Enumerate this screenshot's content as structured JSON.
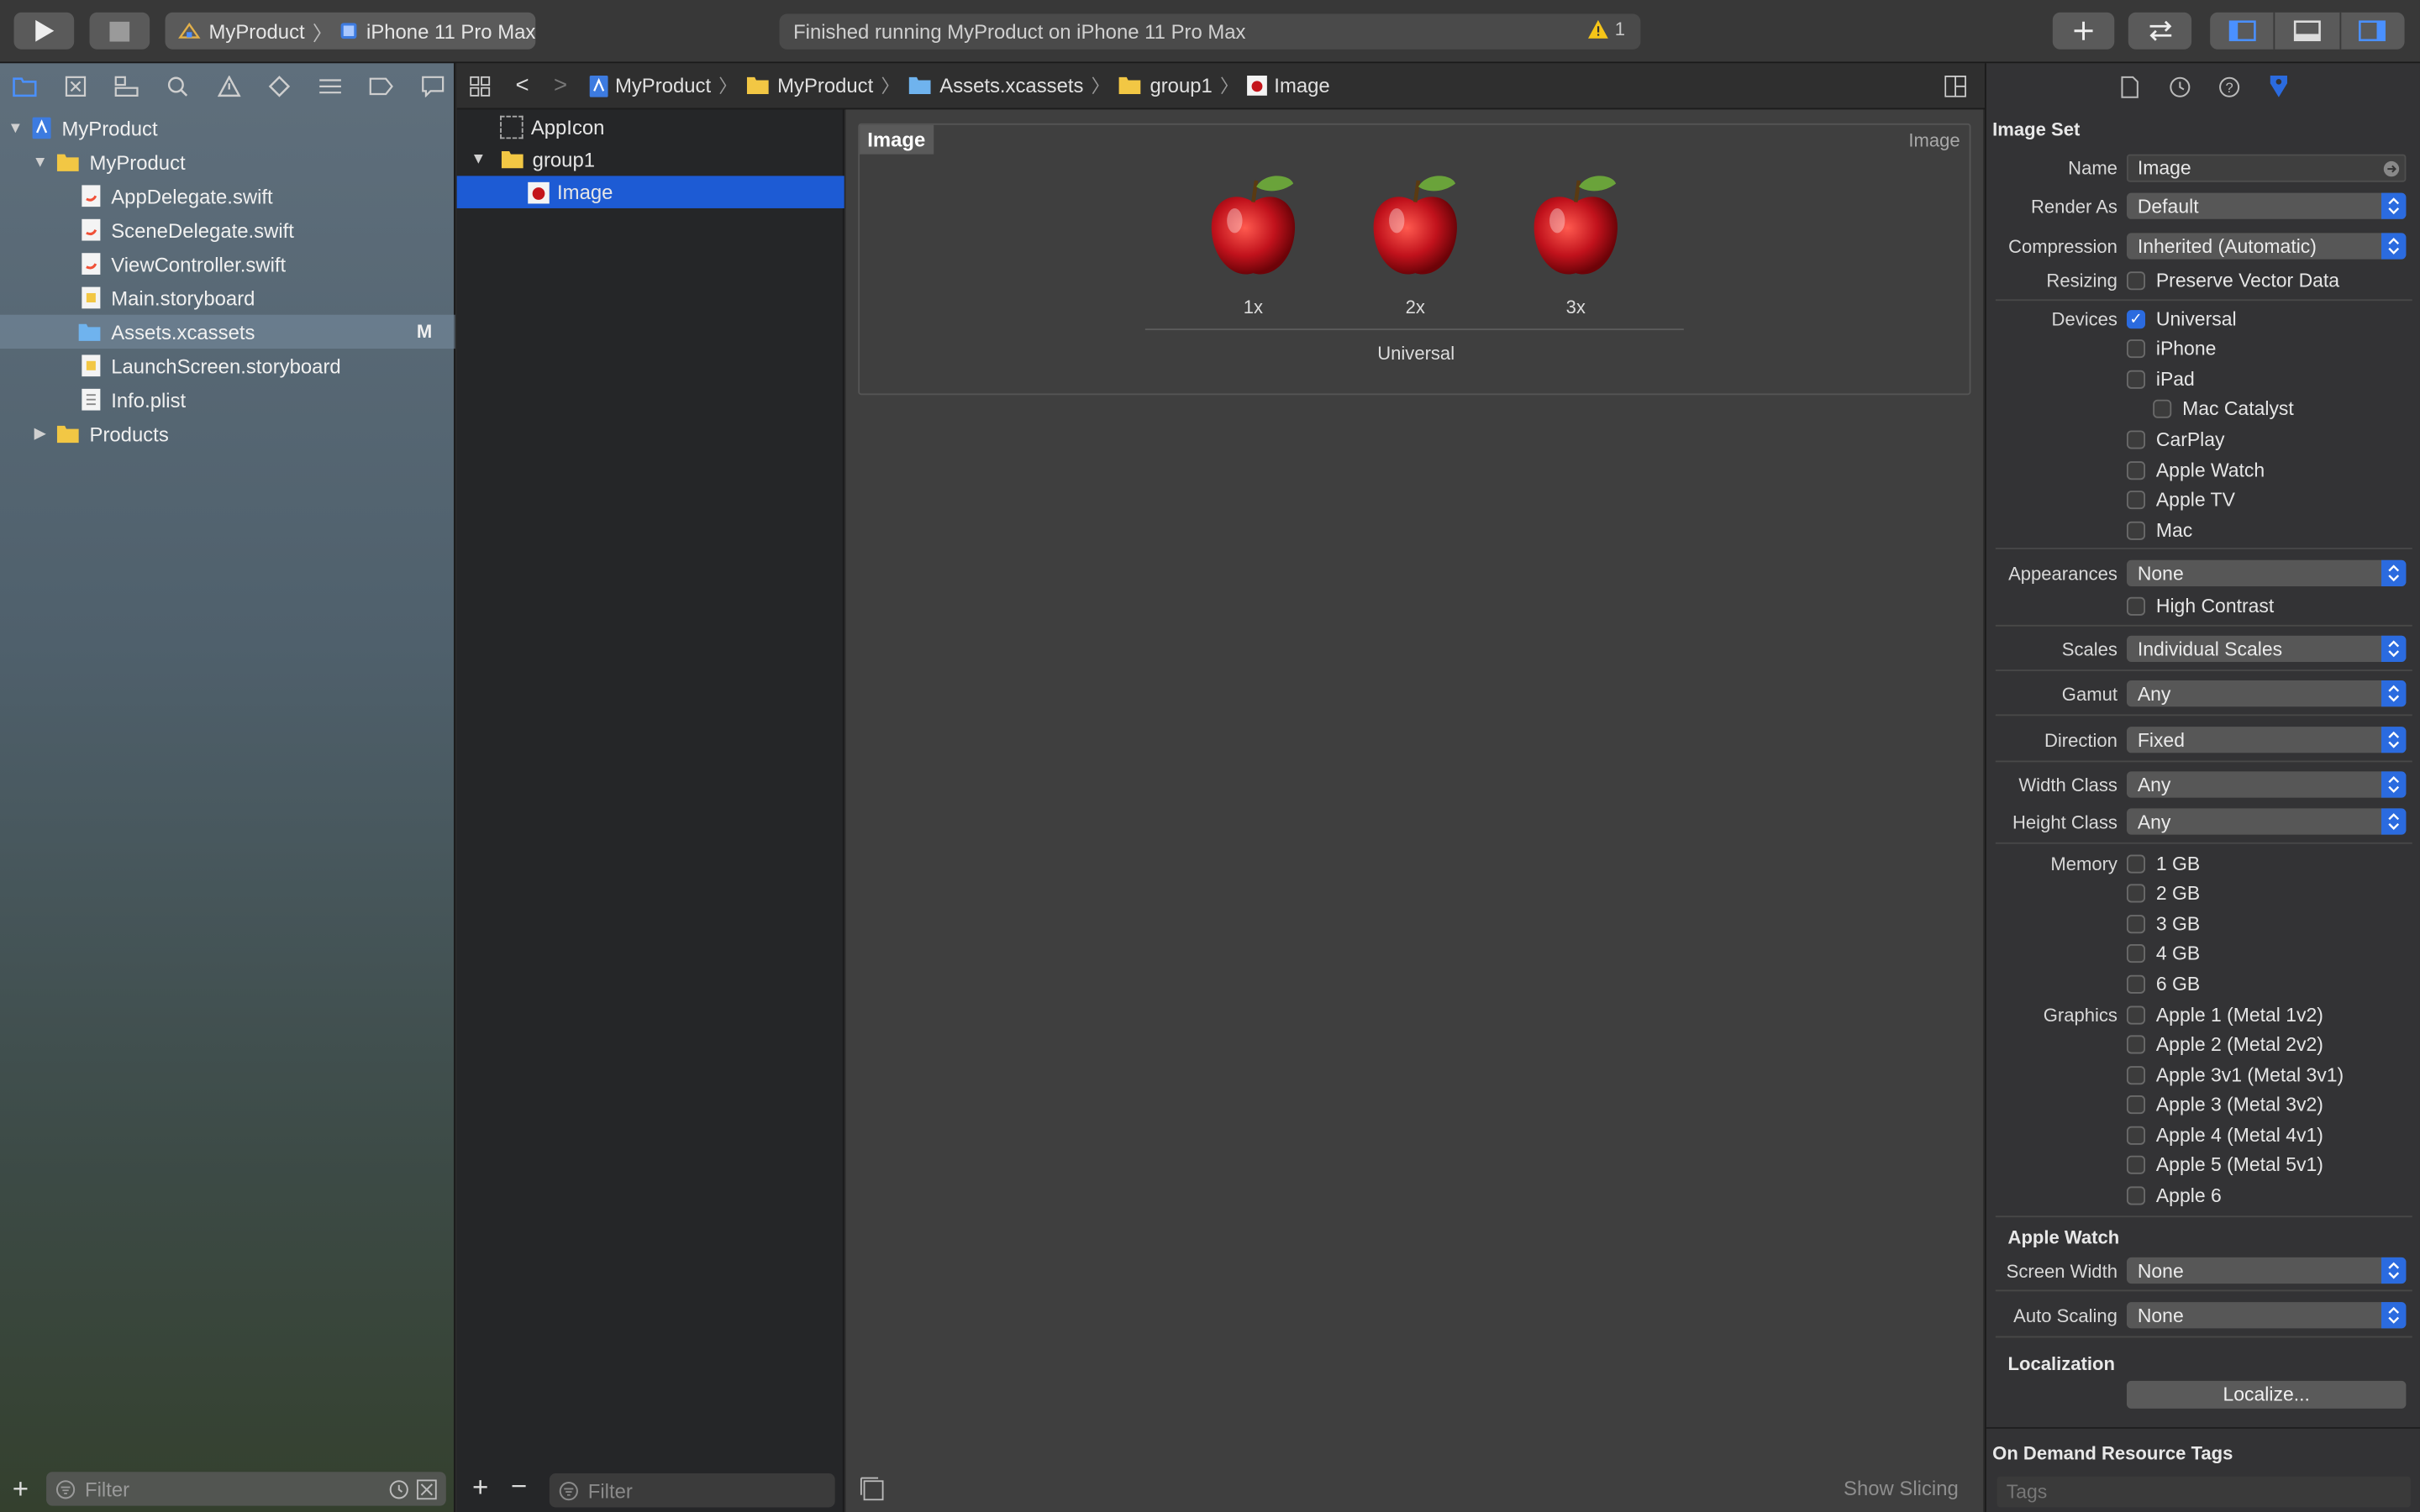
{
  "toolbar": {
    "scheme": {
      "project": "MyProduct",
      "device": "iPhone 11 Pro Max"
    },
    "activity_status": "Finished running MyProduct on iPhone 11 Pro Max",
    "warning_count": "1"
  },
  "navigator": {
    "tabs": [
      "project-navigator-icon",
      "source-control-icon",
      "symbol-navigator-icon",
      "find-icon",
      "issue-icon",
      "test-icon",
      "debug-icon",
      "breakpoint-icon",
      "report-icon"
    ],
    "tree": [
      {
        "label": "MyProduct",
        "kind": "project"
      },
      {
        "label": "MyProduct",
        "kind": "folder"
      },
      {
        "label": "AppDelegate.swift",
        "kind": "swift"
      },
      {
        "label": "SceneDelegate.swift",
        "kind": "swift"
      },
      {
        "label": "ViewController.swift",
        "kind": "swift"
      },
      {
        "label": "Main.storyboard",
        "kind": "storyboard"
      },
      {
        "label": "Assets.xcassets",
        "kind": "assets",
        "badge": "M"
      },
      {
        "label": "LaunchScreen.storyboard",
        "kind": "storyboard"
      },
      {
        "label": "Info.plist",
        "kind": "plist"
      },
      {
        "label": "Products",
        "kind": "folder"
      }
    ],
    "filter_placeholder": "Filter"
  },
  "assets": {
    "items": [
      "AppIcon",
      "group1",
      "Image"
    ],
    "filter_placeholder": "Filter"
  },
  "jumpbar": {
    "crumbs": [
      "MyProduct",
      "MyProduct",
      "Assets.xcassets",
      "group1",
      "Image"
    ]
  },
  "editor": {
    "set_title": "Image",
    "set_kind": "Image",
    "slots": [
      "1x",
      "2x",
      "3x"
    ],
    "universal_label": "Universal",
    "show_slicing": "Show Slicing"
  },
  "inspector": {
    "section_title": "Image Set",
    "name_label": "Name",
    "name_value": "Image",
    "render_as_label": "Render As",
    "render_as_value": "Default",
    "compression_label": "Compression",
    "compression_value": "Inherited (Automatic)",
    "resizing_label": "Resizing",
    "preserve_vector": "Preserve Vector Data",
    "devices_label": "Devices",
    "devices": {
      "universal": "Universal",
      "iphone": "iPhone",
      "ipad": "iPad",
      "mac_catalyst": "Mac Catalyst",
      "carplay": "CarPlay",
      "apple_watch": "Apple Watch",
      "apple_tv": "Apple TV",
      "mac": "Mac"
    },
    "appearances_label": "Appearances",
    "appearances_value": "None",
    "high_contrast": "High Contrast",
    "scales_label": "Scales",
    "scales_value": "Individual Scales",
    "gamut_label": "Gamut",
    "gamut_value": "Any",
    "direction_label": "Direction",
    "direction_value": "Fixed",
    "width_class_label": "Width Class",
    "width_class_value": "Any",
    "height_class_label": "Height Class",
    "height_class_value": "Any",
    "memory_label": "Memory",
    "memory": [
      "1 GB",
      "2 GB",
      "3 GB",
      "4 GB",
      "6 GB"
    ],
    "graphics_label": "Graphics",
    "graphics": [
      "Apple 1 (Metal 1v2)",
      "Apple 2 (Metal 2v2)",
      "Apple 3v1 (Metal 3v1)",
      "Apple 3 (Metal 3v2)",
      "Apple 4 (Metal 4v1)",
      "Apple 5 (Metal 5v1)",
      "Apple 6"
    ],
    "apple_watch_heading": "Apple Watch",
    "screen_width_label": "Screen Width",
    "screen_width_value": "None",
    "auto_scaling_label": "Auto Scaling",
    "auto_scaling_value": "None",
    "localization_heading": "Localization",
    "localize_button": "Localize...",
    "odr_heading": "On Demand Resource Tags",
    "tags_placeholder": "Tags"
  },
  "colors": {
    "accent": "#2b6bdf",
    "selection": "#1d5bd4",
    "warning": "#f5c518"
  }
}
